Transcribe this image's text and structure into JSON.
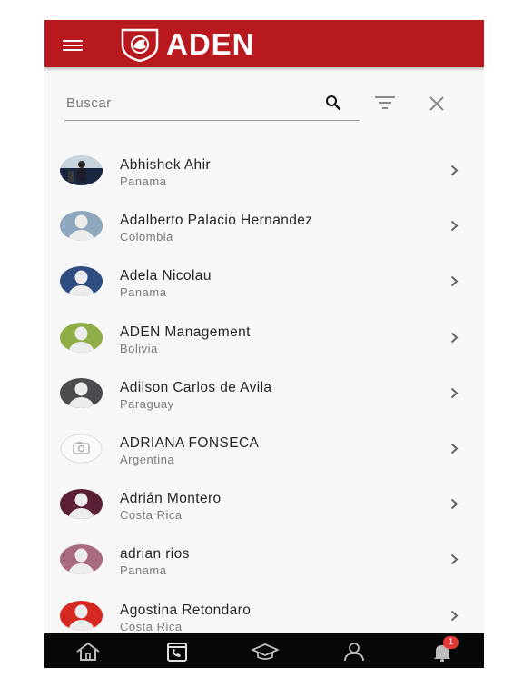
{
  "app": {
    "brand": "ADEN"
  },
  "search": {
    "placeholder": "Buscar",
    "value": ""
  },
  "icons": {
    "menu": "hamburger-menu-icon",
    "search": "search-icon",
    "filter": "filter-icon",
    "clear": "close-icon",
    "chevron": "chevron-right-icon"
  },
  "contacts": [
    {
      "name": "Abhishek Ahir",
      "country": "Panama",
      "avatar_color": "#1a2740",
      "photo": true
    },
    {
      "name": "Adalberto Palacio Hernandez",
      "country": "Colombia",
      "avatar_color": "#8fa6bf"
    },
    {
      "name": "Adela Nicolau",
      "country": "Panama",
      "avatar_color": "#2f4d80"
    },
    {
      "name": "ADEN Management",
      "country": "Bolivia",
      "avatar_color": "#8fae47"
    },
    {
      "name": "Adilson Carlos de Avila",
      "country": "Paraguay",
      "avatar_color": "#4a4c4f"
    },
    {
      "name": "ADRIANA FONSECA",
      "country": "Argentina",
      "avatar_color": "#f2f2f2",
      "placeholder": true
    },
    {
      "name": "Adrián Montero",
      "country": "Costa Rica",
      "avatar_color": "#5a1e36"
    },
    {
      "name": "adrian rios",
      "country": "Panama",
      "avatar_color": "#a86a80"
    },
    {
      "name": "Agostina Retondaro",
      "country": "Costa Rica",
      "avatar_color": "#d52a22"
    }
  ],
  "bottom_nav": [
    {
      "icon": "home-icon"
    },
    {
      "icon": "contacts-phone-icon",
      "active": true
    },
    {
      "icon": "graduation-cap-icon"
    },
    {
      "icon": "user-icon"
    },
    {
      "icon": "bell-icon",
      "badge": "1"
    }
  ],
  "colors": {
    "brand_red": "#b8191e",
    "nav_bg": "#070707",
    "badge_red": "#e53935"
  }
}
